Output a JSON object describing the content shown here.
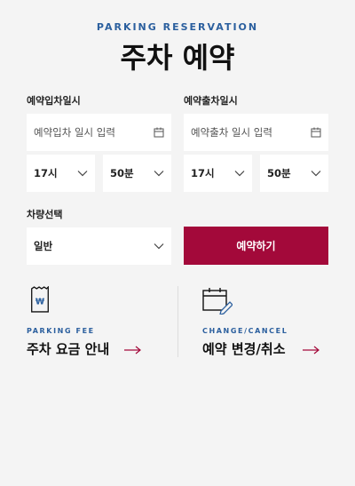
{
  "header": {
    "eyebrow": "PARKING RESERVATION",
    "title": "주차 예약"
  },
  "form": {
    "entry": {
      "label": "예약입차일시",
      "date_placeholder": "예약입차 일시 입력",
      "hour": "17시",
      "minute": "50분"
    },
    "exit": {
      "label": "예약출차일시",
      "date_placeholder": "예약출차 일시 입력",
      "hour": "17시",
      "minute": "50분"
    },
    "vehicle": {
      "label": "차량선택",
      "value": "일반"
    },
    "reserve_label": "예약하기"
  },
  "info": {
    "fee": {
      "eyebrow": "PARKING FEE",
      "title": "주차 요금 안내"
    },
    "change": {
      "eyebrow": "CHANGE/CANCEL",
      "title": "예약 변경/취소"
    }
  },
  "colors": {
    "accent": "#a3093a",
    "eyebrow_blue": "#2b5f9e",
    "background": "#f4f4f4"
  }
}
